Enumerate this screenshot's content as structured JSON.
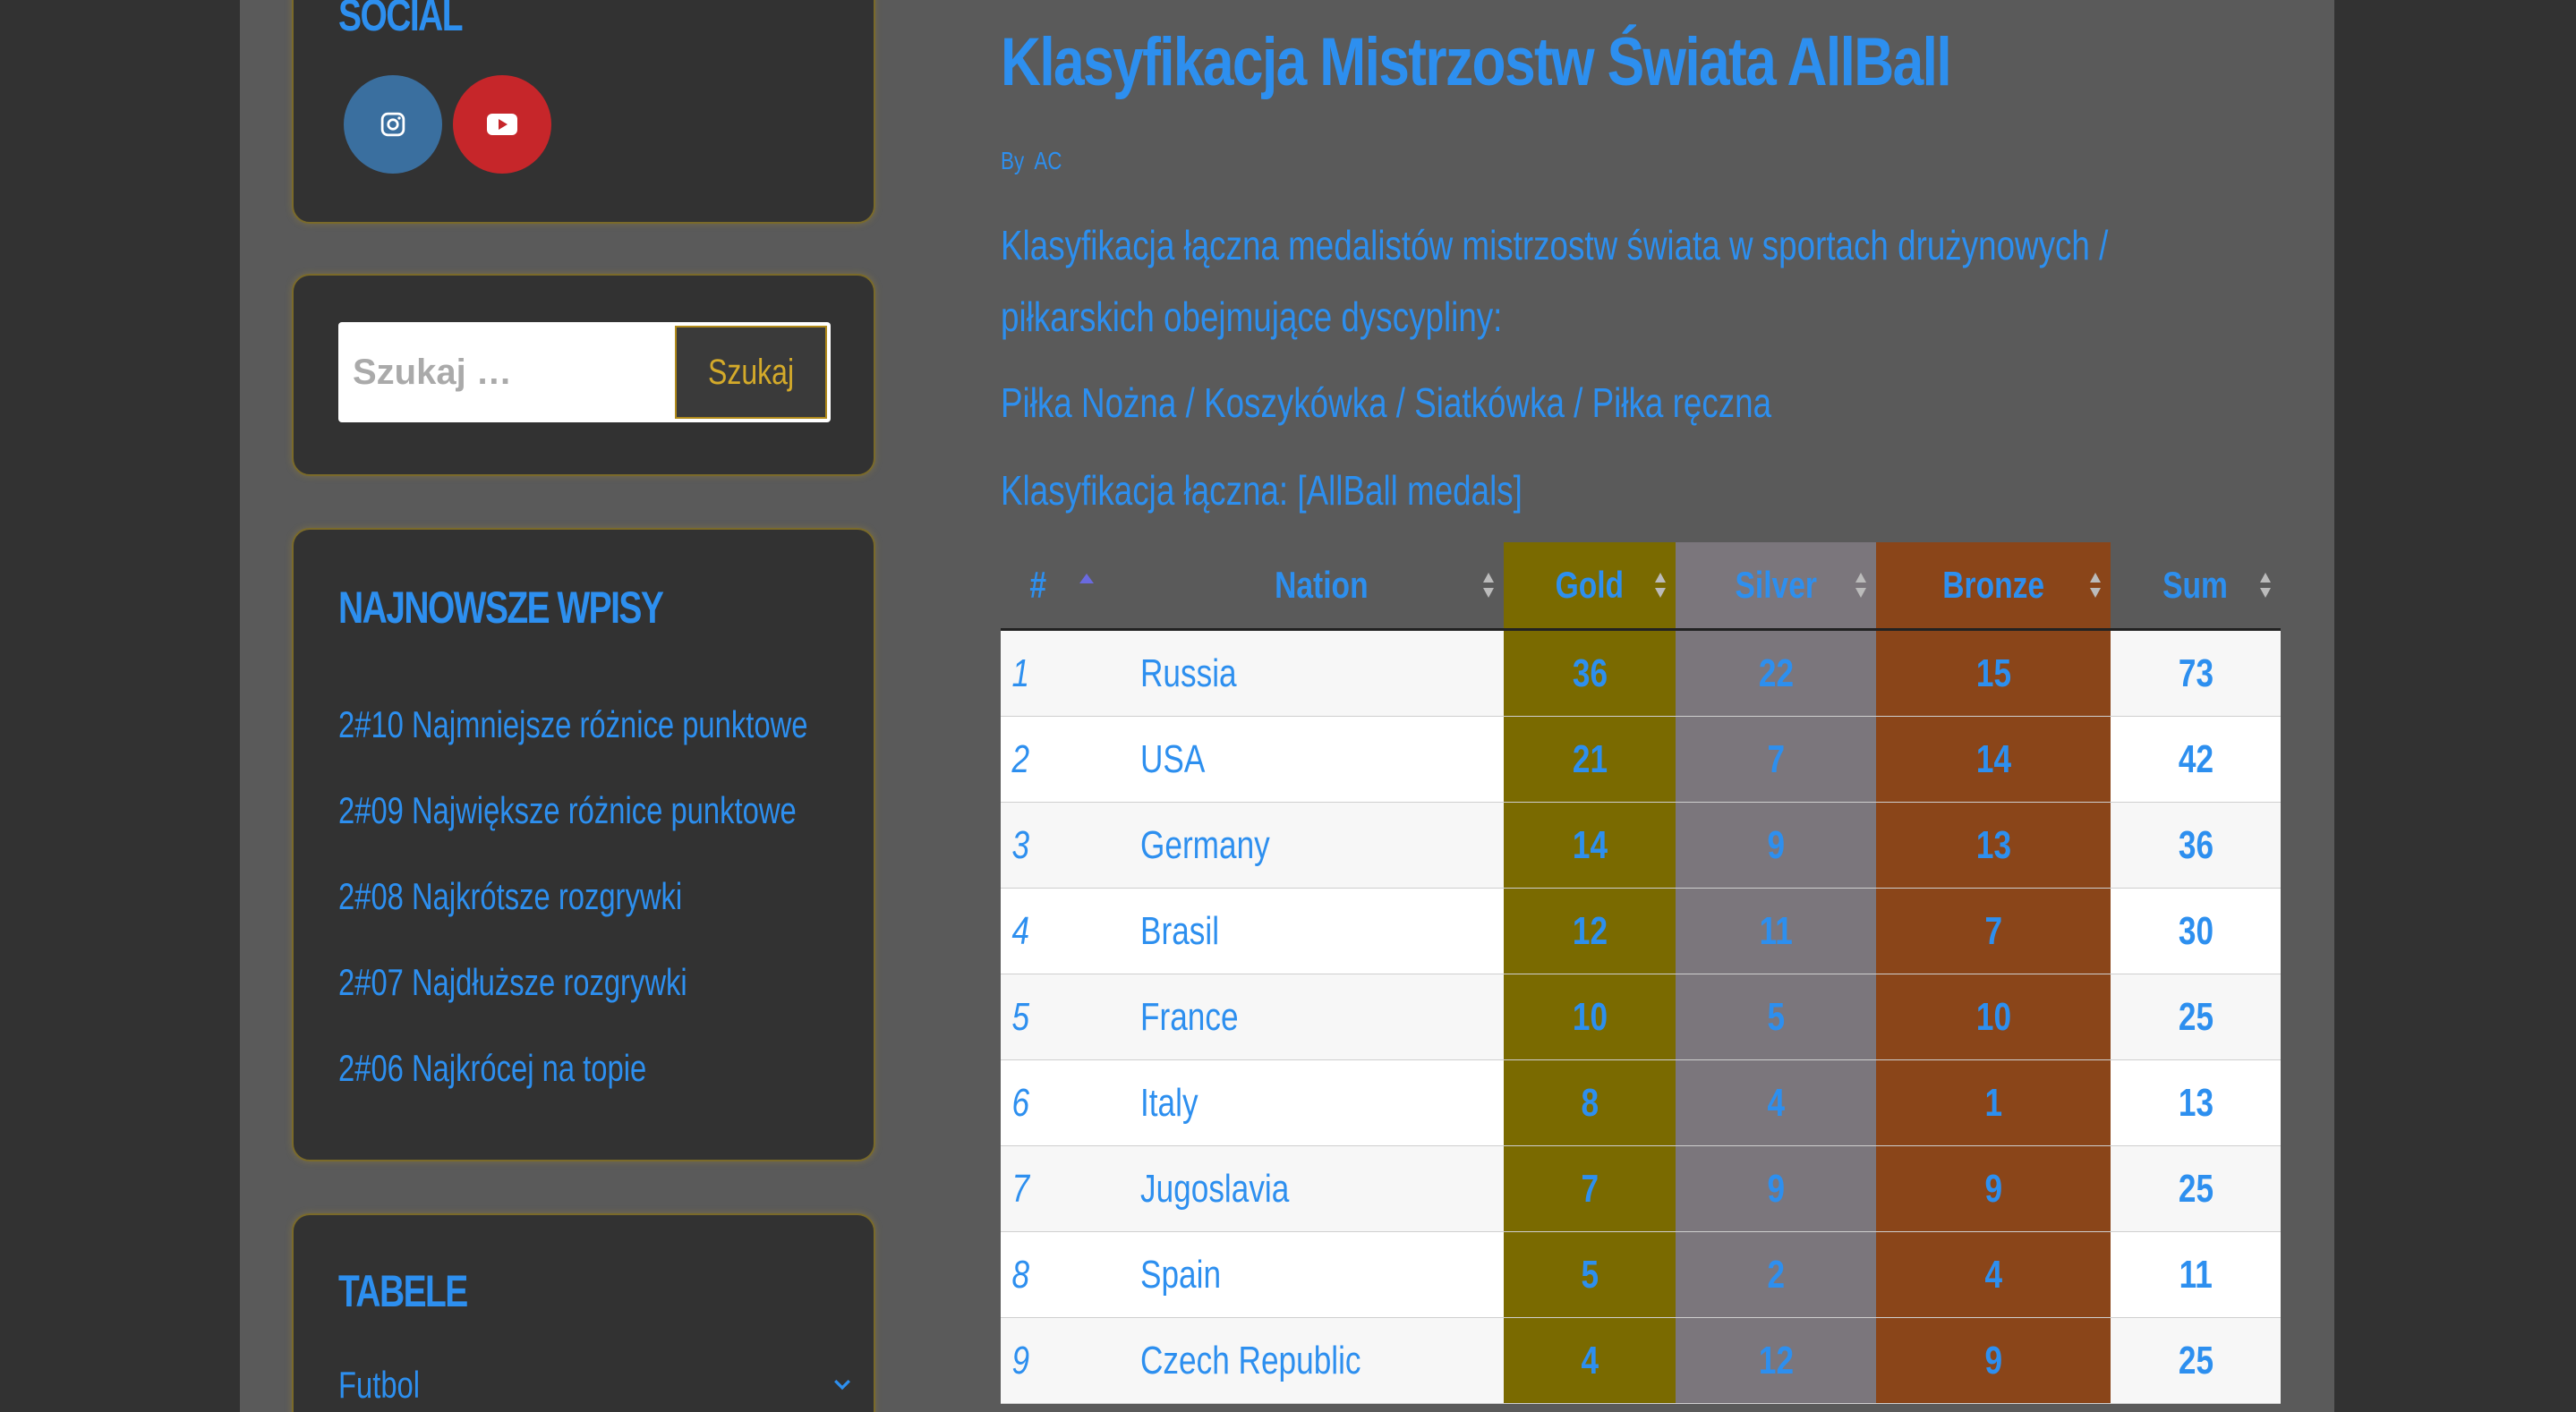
{
  "sidebar": {
    "social": {
      "title": "SOCIAL",
      "links": [
        {
          "icon": "instagram-icon",
          "color": "#3a6f9f"
        },
        {
          "icon": "youtube-icon",
          "color": "#c6262a"
        }
      ]
    },
    "search": {
      "placeholder": "Szukaj …",
      "button_label": "Szukaj"
    },
    "recent_posts": {
      "title": "NAJNOWSZE WPISY",
      "items": [
        "2#10 Najmniejsze różnice punktowe",
        "2#09 Największe różnice punktowe",
        "2#08 Najkrótsze rozgrywki",
        "2#07 Najdłuższe rozgrywki",
        "2#06 Najkrócej na topie"
      ]
    },
    "tables": {
      "title": "TABELE",
      "items": [
        "Futbol"
      ]
    }
  },
  "post": {
    "title": "Klasyfikacja Mistrzostw Świata AllBall",
    "byline_prefix": "By",
    "author": "AC",
    "intro": "Klasyfikacja łączna medalistów mistrzostw świata w sportach drużynowych / piłkarskich obejmujące dyscypliny:",
    "disciplines": "Piłka Nożna / Koszykówka / Siatkówka / Piłka ręczna",
    "classification_label": "Klasyfikacja łączna: [AllBall medals]"
  },
  "medal_table": {
    "headers": {
      "rank": "#",
      "nation": "Nation",
      "gold": "Gold",
      "silver": "Silver",
      "bronze": "Bronze",
      "sum": "Sum"
    },
    "colors": {
      "gold": "#7a6a00",
      "silver": "#7b767c",
      "bronze": "#8a4519",
      "text": "#2d8fef"
    },
    "rows": [
      {
        "rank": "1",
        "nation": "Russia",
        "gold": "36",
        "silver": "22",
        "bronze": "15",
        "sum": "73"
      },
      {
        "rank": "2",
        "nation": "USA",
        "gold": "21",
        "silver": "7",
        "bronze": "14",
        "sum": "42"
      },
      {
        "rank": "3",
        "nation": "Germany",
        "gold": "14",
        "silver": "9",
        "bronze": "13",
        "sum": "36"
      },
      {
        "rank": "4",
        "nation": "Brasil",
        "gold": "12",
        "silver": "11",
        "bronze": "7",
        "sum": "30"
      },
      {
        "rank": "5",
        "nation": "France",
        "gold": "10",
        "silver": "5",
        "bronze": "10",
        "sum": "25"
      },
      {
        "rank": "6",
        "nation": "Italy",
        "gold": "8",
        "silver": "4",
        "bronze": "1",
        "sum": "13"
      },
      {
        "rank": "7",
        "nation": "Jugoslavia",
        "gold": "7",
        "silver": "9",
        "bronze": "9",
        "sum": "25"
      },
      {
        "rank": "8",
        "nation": "Spain",
        "gold": "5",
        "silver": "2",
        "bronze": "4",
        "sum": "11"
      },
      {
        "rank": "9",
        "nation": "Czech Republic",
        "gold": "4",
        "silver": "12",
        "bronze": "9",
        "sum": "25"
      }
    ]
  }
}
